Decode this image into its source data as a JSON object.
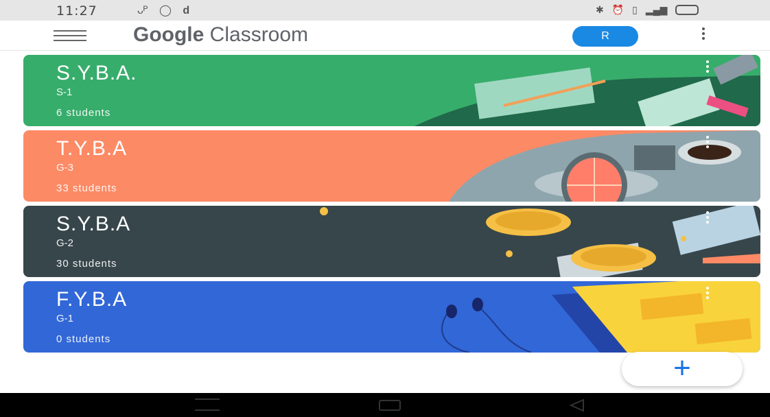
{
  "status_bar": {
    "time": "11:27",
    "left_icons": [
      "vodafone-icon",
      "whatsapp-icon",
      "d-app-icon"
    ],
    "right_icons": [
      "bluetooth-icon",
      "alarm-icon",
      "vibrate-icon",
      "signal-icon",
      "battery-icon"
    ]
  },
  "app_bar": {
    "title_brand": "Google",
    "title_product": " Classroom",
    "avatar_initial": "R"
  },
  "classes": [
    {
      "name": "S.Y.B.A.",
      "section": "S-1",
      "students": "6 students",
      "color": "#37ad6b",
      "theme": "books"
    },
    {
      "name": "T.Y.B.A",
      "section": "G-3",
      "students": "33 students",
      "color": "#fc8a65",
      "theme": "coffee"
    },
    {
      "name": "S.Y.B.A",
      "section": "G-2",
      "students": "30 students",
      "color": "#37464b",
      "theme": "coins"
    },
    {
      "name": "F.Y.B.A",
      "section": "G-1",
      "students": "0 students",
      "color": "#3167d7",
      "theme": "headphones"
    }
  ],
  "fab": {
    "label": "+"
  },
  "colors": {
    "accent": "#1a73e8",
    "avatar": "#1a89e4"
  }
}
